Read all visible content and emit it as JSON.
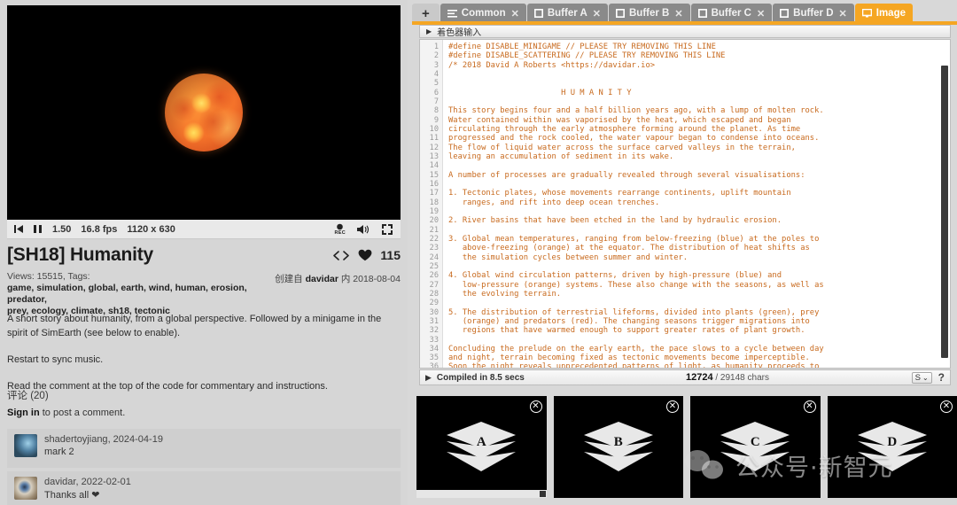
{
  "player": {
    "restart_icon": "skip-back-icon",
    "pause_icon": "pause-icon",
    "time": "1.50",
    "fps": "16.8 fps",
    "resolution": "1120 x 630",
    "rec_label": "REC",
    "rec_icon": "record-icon",
    "volume_icon": "volume-icon",
    "fullscreen_icon": "fullscreen-icon"
  },
  "shader": {
    "title": "[SH18] Humanity",
    "embed_icon": "code-embed-icon",
    "heart_icon": "heart-icon",
    "likes": "115",
    "views_label": "Views: 15515, Tags:",
    "tags_line1": "game, simulation, global, earth, wind, human, erosion, predator,",
    "tags_line2": "prey, ecology, climate, sh18, tectonic",
    "created_prefix": "创建自",
    "author": "davidar",
    "created_mid": "内",
    "created_date": "2018-08-04",
    "description": [
      "A short story about humanity, from a global perspective. Followed by a minigame in the spirit of SimEarth (see below to enable).",
      "Restart to sync music.",
      "Read the comment at the top of the code for commentary and instructions."
    ]
  },
  "comments": {
    "header": "评论 (20)",
    "signin_label": "Sign in",
    "signin_rest": " to post a comment.",
    "items": [
      {
        "name": "shadertoyjiang",
        "date": ", 2024-04-19",
        "body": "mark 2"
      },
      {
        "name": "davidar",
        "date": ", 2022-02-01",
        "body": "Thanks all ❤"
      }
    ]
  },
  "editor": {
    "tabs": [
      {
        "label": "+",
        "type": "add",
        "icon": "plus-icon",
        "closable": false,
        "active": false
      },
      {
        "label": "Common",
        "icon": "lines-icon",
        "closable": true,
        "active": false
      },
      {
        "label": "Buffer A",
        "icon": "square-icon",
        "closable": true,
        "active": false
      },
      {
        "label": "Buffer B",
        "icon": "square-icon",
        "closable": true,
        "active": false
      },
      {
        "label": "Buffer C",
        "icon": "square-icon",
        "closable": true,
        "active": false
      },
      {
        "label": "Buffer D",
        "icon": "square-icon",
        "closable": true,
        "active": false
      },
      {
        "label": "Image",
        "icon": "monitor-icon",
        "closable": false,
        "active": true
      }
    ],
    "close_glyph": "✕",
    "inputs_panel_label": "着色器输入",
    "inputs_panel_arrow": "▶",
    "accent_color": "#f5a623",
    "code_color": "#c86a1e",
    "first_line": 1,
    "code_lines": [
      "#define DISABLE_MINIGAME // PLEASE TRY REMOVING THIS LINE",
      "#define DISABLE_SCATTERING // PLEASE TRY REMOVING THIS LINE",
      "/* 2018 David A Roberts <https://davidar.io>",
      "",
      "",
      "                        H U M A N I T Y",
      "",
      "This story begins four and a half billion years ago, with a lump of molten rock.",
      "Water contained within was vaporised by the heat, which escaped and began",
      "circulating through the early atmosphere forming around the planet. As time",
      "progressed and the rock cooled, the water vapour began to condense into oceans.",
      "The flow of liquid water across the surface carved valleys in the terrain,",
      "leaving an accumulation of sediment in its wake.",
      "",
      "A number of processes are gradually revealed through several visualisations:",
      "",
      "1. Tectonic plates, whose movements rearrange continents, uplift mountain",
      "   ranges, and rift into deep ocean trenches.",
      "",
      "2. River basins that have been etched in the land by hydraulic erosion.",
      "",
      "3. Global mean temperatures, ranging from below-freezing (blue) at the poles to",
      "   above-freezing (orange) at the equator. The distribution of heat shifts as",
      "   the simulation cycles between summer and winter.",
      "",
      "4. Global wind circulation patterns, driven by high-pressure (blue) and",
      "   low-pressure (orange) systems. These also change with the seasons, as well as",
      "   the evolving terrain.",
      "",
      "5. The distribution of terrestrial lifeforms, divided into plants (green), prey",
      "   (orange) and predators (red). The changing seasons trigger migrations into",
      "   regions that have warmed enough to support greater rates of plant growth.",
      "",
      "Concluding the prelude on the early earth, the pace slows to a cycle between day",
      "and night, terrain becoming fixed as tectonic movements become imperceptible.",
      "Soon the night reveals unprecedented patterns of light, as humanity proceeds to"
    ]
  },
  "status": {
    "arrow": "▶",
    "compiled": "Compiled in 8.5 secs",
    "chars_used": "12724",
    "chars_total": " / 29148 chars",
    "select_value": "S",
    "select_arrow": "⌄",
    "help": "?"
  },
  "channels": [
    {
      "label": "A",
      "icon": "buffer-layers-icon",
      "close": "✕"
    },
    {
      "label": "B",
      "icon": "buffer-layers-icon",
      "close": "✕"
    },
    {
      "label": "C",
      "icon": "buffer-layers-icon",
      "close": "✕"
    },
    {
      "label": "D",
      "icon": "buffer-layers-icon",
      "close": "✕"
    }
  ],
  "watermark": {
    "text": "公众号·新智元"
  }
}
